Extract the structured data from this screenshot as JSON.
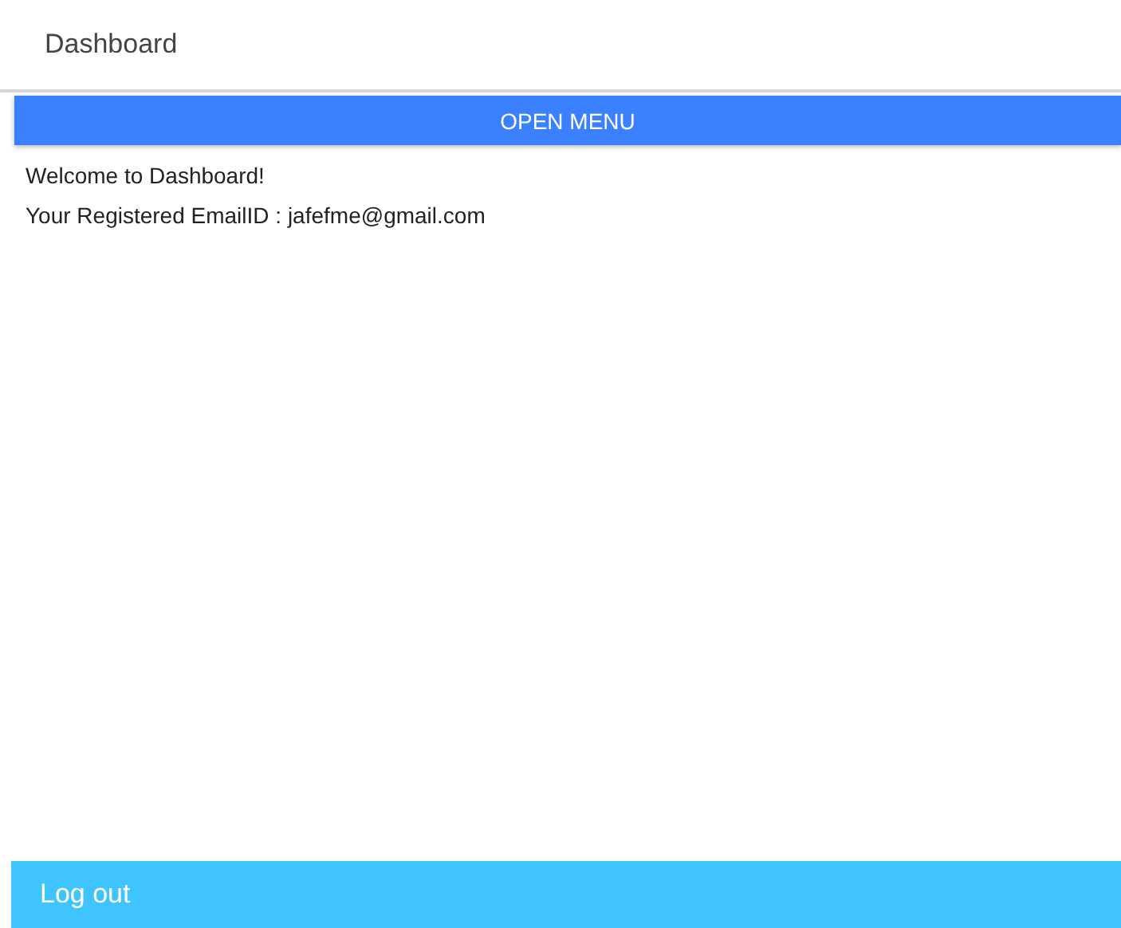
{
  "header": {
    "title": "Dashboard"
  },
  "menu_button": {
    "label": "OPEN MENU"
  },
  "content": [
    "Welcome to Dashboard!",
    "Your Registered EmailID : jafefme@gmail.com"
  ],
  "footer": {
    "button": "Log out"
  }
}
